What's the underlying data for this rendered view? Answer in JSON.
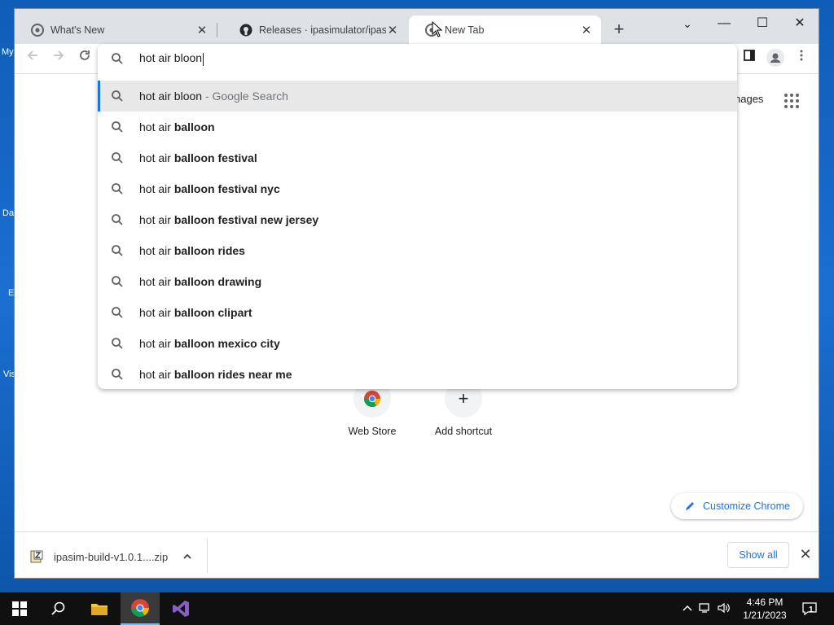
{
  "desktop": {
    "labels": [
      "My",
      "Da",
      "E",
      "Vis"
    ]
  },
  "tabs": [
    {
      "title": "What's New",
      "close": "✕"
    },
    {
      "title": "Releases · ipasimulator/ipasim · G",
      "close": "✕"
    },
    {
      "title": "New Tab",
      "close": "✕"
    }
  ],
  "new_tab_symbol": "+",
  "window_controls": {
    "minimize": "—",
    "maximize": "☐",
    "close": "✕",
    "menu": "⌄"
  },
  "omnibox": {
    "query": "hot air bloon",
    "suggestions": [
      {
        "prefix": "hot air bloon",
        "bold": "",
        "suffix": " - Google Search"
      },
      {
        "prefix": "hot air ",
        "bold": "balloon",
        "suffix": ""
      },
      {
        "prefix": "hot air ",
        "bold": "balloon festival",
        "suffix": ""
      },
      {
        "prefix": "hot air ",
        "bold": "balloon festival nyc",
        "suffix": ""
      },
      {
        "prefix": "hot air ",
        "bold": "balloon festival new jersey",
        "suffix": ""
      },
      {
        "prefix": "hot air ",
        "bold": "balloon rides",
        "suffix": ""
      },
      {
        "prefix": "hot air ",
        "bold": "balloon drawing",
        "suffix": ""
      },
      {
        "prefix": "hot air ",
        "bold": "balloon clipart",
        "suffix": ""
      },
      {
        "prefix": "hot air ",
        "bold": "balloon mexico city",
        "suffix": ""
      },
      {
        "prefix": "hot air ",
        "bold": "balloon rides near me",
        "suffix": ""
      }
    ]
  },
  "page": {
    "images_link": "nages",
    "shortcuts": [
      {
        "label": "Web Store",
        "icon": "chrome-web-store-icon"
      },
      {
        "label": "Add shortcut",
        "icon": "plus-icon",
        "symbol": "+"
      }
    ],
    "customize_label": "Customize Chrome"
  },
  "download_bar": {
    "filename": "ipasim-build-v1.0.1....zip",
    "show_all": "Show all",
    "close": "✕"
  },
  "taskbar": {
    "time": "4:46 PM",
    "date": "1/21/2023",
    "notification_count": "1"
  },
  "colors": {
    "accent": "#1a73e8",
    "tabstrip": "#dee1e6",
    "selected_row": "#e8e8e8",
    "taskbar": "#101010"
  }
}
